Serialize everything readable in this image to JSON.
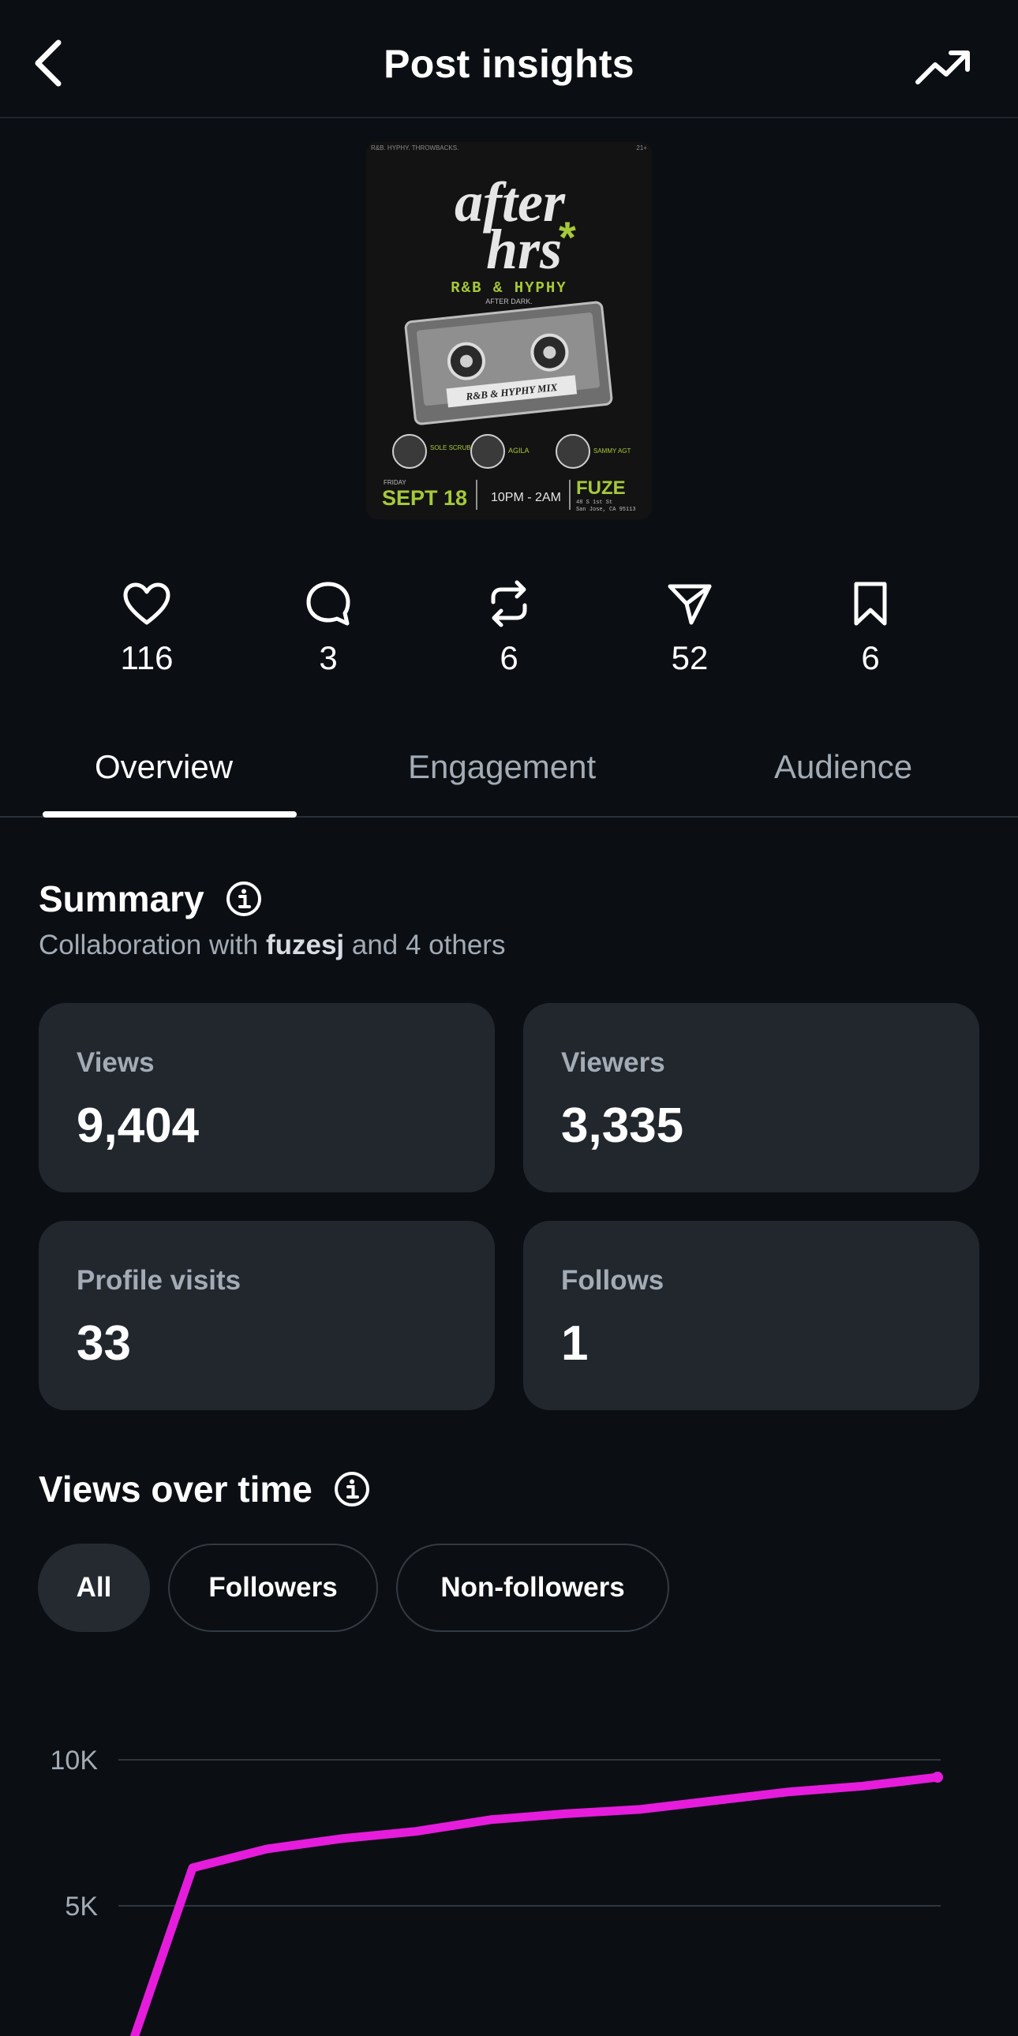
{
  "header": {
    "title": "Post insights"
  },
  "stats": [
    {
      "icon": "heart-icon",
      "value": "116"
    },
    {
      "icon": "comment-icon",
      "value": "3"
    },
    {
      "icon": "repost-icon",
      "value": "6"
    },
    {
      "icon": "share-icon",
      "value": "52"
    },
    {
      "icon": "bookmark-icon",
      "value": "6"
    }
  ],
  "tabs": [
    {
      "label": "Overview",
      "active": true
    },
    {
      "label": "Engagement",
      "active": false
    },
    {
      "label": "Audience",
      "active": false
    }
  ],
  "summary": {
    "title": "Summary",
    "collab_prefix": "Collaboration with ",
    "collab_user": "fuzesj",
    "collab_suffix": " and 4 others",
    "cards": [
      {
        "label": "Views",
        "value": "9,404"
      },
      {
        "label": "Viewers",
        "value": "3,335"
      },
      {
        "label": "Profile visits",
        "value": "33"
      },
      {
        "label": "Follows",
        "value": "1"
      }
    ]
  },
  "views_over_time": {
    "title": "Views over time",
    "filters": [
      {
        "label": "All",
        "active": true
      },
      {
        "label": "Followers",
        "active": false
      },
      {
        "label": "Non-followers",
        "active": false
      }
    ]
  },
  "poster": {
    "top_left": "R&B. HYPHY. THROWBACKS.",
    "top_right": "21+",
    "title_line1": "after",
    "title_line2": "hrs",
    "genre": "R&B & HYPHY",
    "tagline": "AFTER DARK.",
    "cassette_label": "R&B & HYPHY MIX",
    "djs": [
      "SOLE SCRUBS",
      "AGILA",
      "SAMMY AGT"
    ],
    "day": "FRIDAY",
    "date": "SEPT 18",
    "time": "10PM - 2AM",
    "venue": "FUZE",
    "address1": "48 S 1st St",
    "address2": "San Jose, CA 95113"
  },
  "colors": {
    "accent_line": "#e61cdc",
    "poster_green": "#a6c93a"
  },
  "chart_data": {
    "type": "line",
    "title": "",
    "xlabel": "",
    "ylabel": "",
    "y_ticks": [
      "10K",
      "5K"
    ],
    "ylim": [
      0,
      10000
    ],
    "grid": true,
    "series": [
      {
        "values": [
          0,
          6300,
          6950,
          7300,
          7550,
          7950,
          8150,
          8300,
          8600,
          8900,
          9100,
          9404
        ]
      }
    ]
  }
}
